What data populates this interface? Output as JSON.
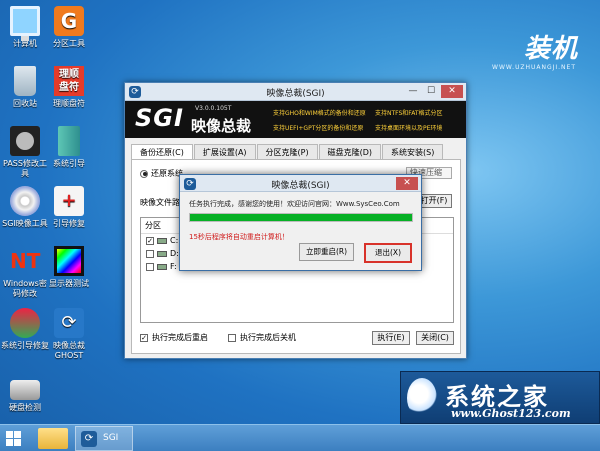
{
  "desktop": {
    "icons": [
      {
        "label": "计算机"
      },
      {
        "label": "分区工具"
      },
      {
        "label": "回收站"
      },
      {
        "label": "理顺 盘符"
      },
      {
        "label": "理顺盘符"
      },
      {
        "label": "PASS修改工具"
      },
      {
        "label": "系统引导"
      },
      {
        "label": "SGI映像工具"
      },
      {
        "label": "引导修复"
      },
      {
        "label": "Windows密码修改"
      },
      {
        "label": "显示器测试"
      },
      {
        "label": "系统引导修复"
      },
      {
        "label": "映像总裁 GHOST"
      },
      {
        "label": "硬盘检测"
      }
    ],
    "brand_logo": "装机",
    "brand_url": "WWW.UZHUANGJI.NET"
  },
  "main_window": {
    "title": "映像总裁(SGI)",
    "banner": {
      "logo": "SGI",
      "version": "V3.0.0.105T",
      "product": "映像总裁",
      "features": [
        "支持GHO和WIM格式的备份和还原",
        "支持NTFS和FAT格式分区",
        "支持UEFI+GPT分区的备份和还原",
        "支持桌面环境以及PE环境"
      ]
    },
    "tabs": [
      "备份还原(C)",
      "扩展设置(A)",
      "分区克隆(P)",
      "磁盘克隆(D)",
      "系统安装(S)"
    ],
    "restore_radio": "还原系统",
    "compression": "快速压缩",
    "path_label": "映像文件路径",
    "open_button": "打开(F)",
    "partition_header": "分区",
    "partitions": [
      {
        "checked": "✓",
        "label": "C:"
      },
      {
        "checked": "",
        "label": "D:"
      },
      {
        "checked": "",
        "label": "F:"
      }
    ],
    "partition_tail": "G",
    "opt_restart": "执行完成后重启",
    "opt_shutdown": "执行完成后关机",
    "execute_button": "执行(E)",
    "close_button": "关闭(C)"
  },
  "dialog": {
    "title": "映像总裁(SGI)",
    "message": "任务执行完成，感谢您的使用！欢迎访问官网：Www.SysCeo.Com",
    "progress": 1.0,
    "countdown": "15秒后程序将自动重启计算机！",
    "restart_button": "立即重启(R)",
    "exit_button": "退出(X)"
  },
  "watermark": {
    "title": "系统之家",
    "url": "www.Ghost123.com"
  },
  "taskbar": {
    "app_label": "SGI"
  },
  "colors": {
    "desktop_blue": "#1f72c2",
    "progress_green": "#06b025",
    "highlight_red": "#d8322a"
  }
}
